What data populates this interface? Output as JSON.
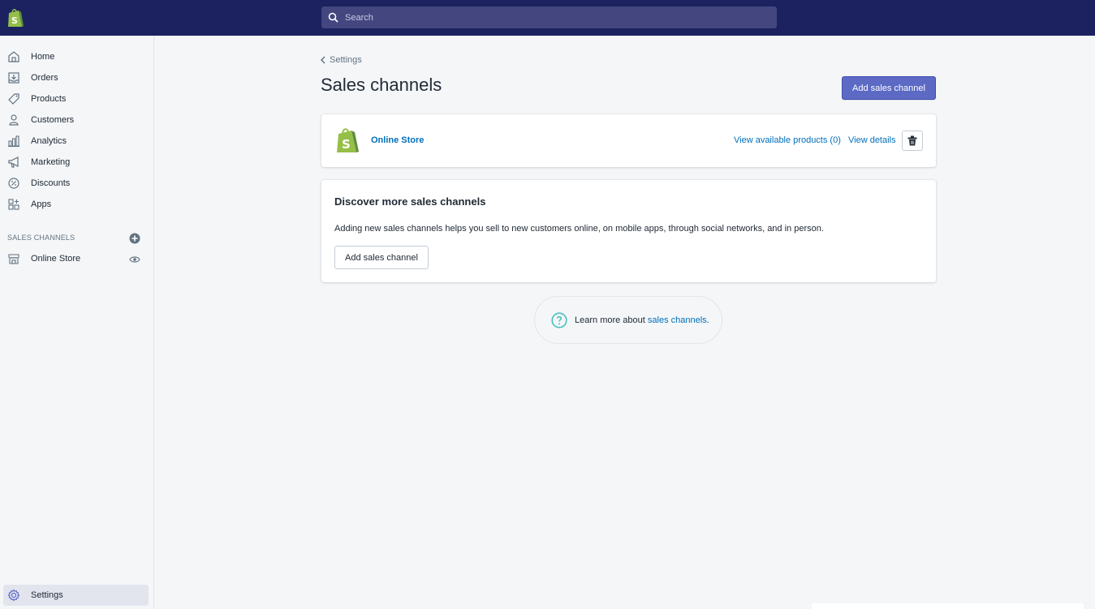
{
  "search": {
    "placeholder": "Search",
    "icon": "search-icon"
  },
  "sidebar": {
    "items": [
      {
        "label": "Home",
        "icon": "home-icon"
      },
      {
        "label": "Orders",
        "icon": "orders-icon"
      },
      {
        "label": "Products",
        "icon": "tag-icon"
      },
      {
        "label": "Customers",
        "icon": "person-icon"
      },
      {
        "label": "Analytics",
        "icon": "bar-chart-icon"
      },
      {
        "label": "Marketing",
        "icon": "megaphone-icon"
      },
      {
        "label": "Discounts",
        "icon": "discount-icon"
      },
      {
        "label": "Apps",
        "icon": "apps-icon"
      }
    ],
    "section_title": "SALES CHANNELS",
    "online_store": "Online Store",
    "settings": "Settings"
  },
  "main": {
    "back_label": "Settings",
    "title": "Sales channels",
    "add_button": "Add sales channel",
    "channel": {
      "name": "Online Store",
      "view_products": "View available products (0)",
      "view_details": "View details"
    },
    "discover": {
      "title": "Discover more sales channels",
      "text": "Adding new sales channels helps you sell to new customers online, on mobile apps, through social networks, and in person.",
      "button": "Add sales channel"
    },
    "learn": {
      "prefix": "Learn more about ",
      "link": "sales channels",
      "suffix": "."
    }
  },
  "colors": {
    "topbar": "#1c2260",
    "primary": "#5c6ac4",
    "link": "#006fbb",
    "shopify_green": "#95bf47"
  }
}
